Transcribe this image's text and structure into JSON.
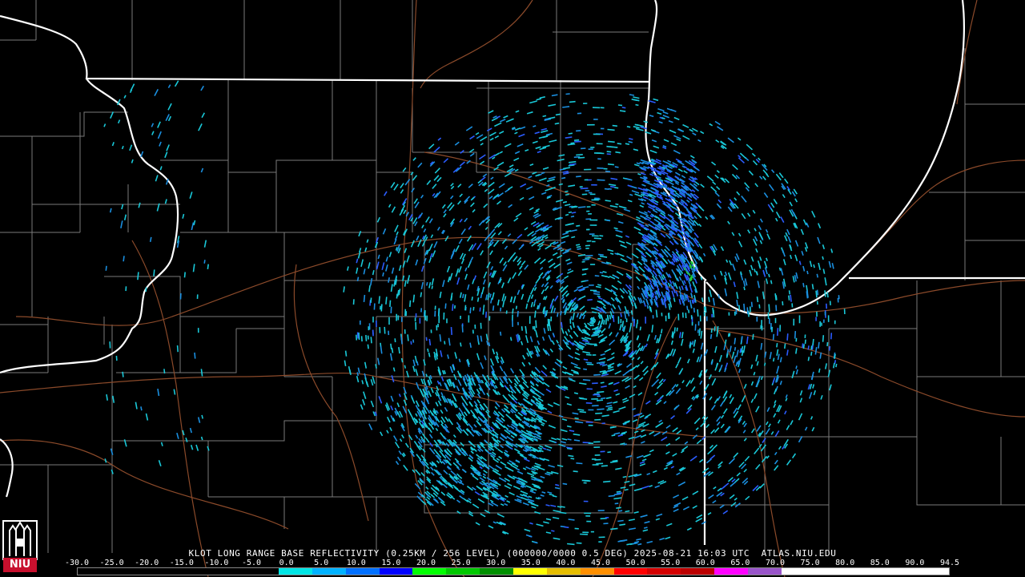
{
  "caption": "KLOT LONG RANGE BASE REFLECTIVITY (0.25KM / 256 LEVEL) (000000/0000 0.5 DEG) 2025-08-21 16:03 UTC  ATLAS.NIU.EDU",
  "radar_site": "KLOT",
  "product": "LONG RANGE BASE REFLECTIVITY",
  "resolution": "0.25KM / 256 LEVEL",
  "elevation": "0.5 DEG",
  "timestamp": "2025-08-21 16:03 UTC",
  "source": "ATLAS.NIU.EDU",
  "logo_text": "NIU",
  "colorbar": {
    "ticks": [
      "-30.0",
      "-25.0",
      "-20.0",
      "-15.0",
      "-10.0",
      "-5.0",
      "0.0",
      "5.0",
      "10.0",
      "15.0",
      "20.0",
      "25.0",
      "30.0",
      "35.0",
      "40.0",
      "45.0",
      "50.0",
      "55.0",
      "60.0",
      "65.0",
      "70.0",
      "75.0",
      "80.0",
      "85.0",
      "90.0",
      "94.5"
    ],
    "colors": [
      "#000000",
      "#000000",
      "#000000",
      "#000000",
      "#000000",
      "#000000",
      "#00e5e5",
      "#00b2ff",
      "#0070ff",
      "#0000ff",
      "#00ff00",
      "#00c800",
      "#009000",
      "#ffff00",
      "#e6be00",
      "#ff9000",
      "#ff0000",
      "#d40000",
      "#bc0000",
      "#ff00ff",
      "#9955c9",
      "#ffffff",
      "#ffffff",
      "#ffffff",
      "#ffffff",
      "#ffffff"
    ]
  },
  "colors": {
    "background": "#000000",
    "state_border": "#ffffff",
    "county_border": "#7a7a7a",
    "roads": "#8b4a2a",
    "echo_light": "#19c8d8",
    "echo_mid": "#1a8fe0",
    "echo_strong": "#2b5cff",
    "echo_green": "#1ecc3a"
  }
}
